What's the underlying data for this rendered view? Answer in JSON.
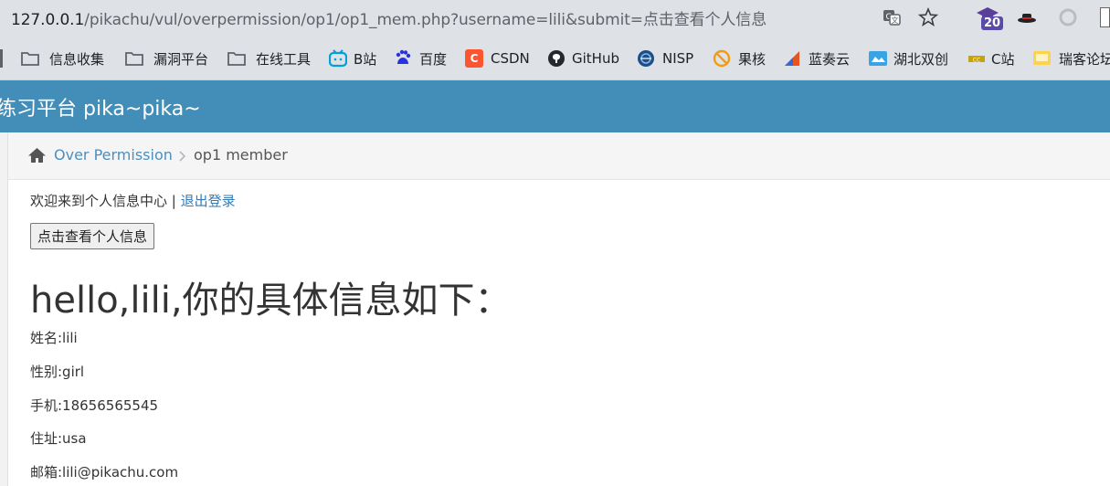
{
  "browser": {
    "url_host": "127.0.0.1",
    "url_rest": "/pikachu/vul/overpermission/op1/op1_mem.php?username=lili&submit=点击查看个人信息",
    "ext_badge": "20"
  },
  "bookmarks": [
    {
      "label": "信息收集",
      "icon": "folder-icon"
    },
    {
      "label": "漏洞平台",
      "icon": "folder-icon"
    },
    {
      "label": "在线工具",
      "icon": "folder-icon"
    },
    {
      "label": "B站",
      "icon": "bilibili-icon"
    },
    {
      "label": "百度",
      "icon": "baidu-icon"
    },
    {
      "label": "CSDN",
      "icon": "csdn-icon"
    },
    {
      "label": "GitHub",
      "icon": "github-icon"
    },
    {
      "label": "NISP",
      "icon": "nisp-icon"
    },
    {
      "label": "果核",
      "icon": "guohe-icon"
    },
    {
      "label": "蓝奏云",
      "icon": "lanzou-icon"
    },
    {
      "label": "湖北双创",
      "icon": "hubei-icon"
    },
    {
      "label": "C站",
      "icon": "c-site-icon"
    },
    {
      "label": "瑞客论坛",
      "icon": "ruike-icon"
    }
  ],
  "header": {
    "brand": "练习平台 pika~pika~"
  },
  "breadcrumb": {
    "parent": "Over Permission",
    "current": "op1 member"
  },
  "main": {
    "welcome": "欢迎来到个人信息中心 | ",
    "logout": "退出登录",
    "view_button": "点击查看个人信息",
    "hello": "hello,lili,你的具体信息如下：",
    "fields": [
      "姓名:lili",
      "性别:girl",
      "手机:18656565545",
      "住址:usa",
      "邮箱:lili@pikachu.com"
    ]
  },
  "colors": {
    "navbar": "#438eb9",
    "link": "#337ab7",
    "breadcrumb_link": "#4c8fbd"
  }
}
